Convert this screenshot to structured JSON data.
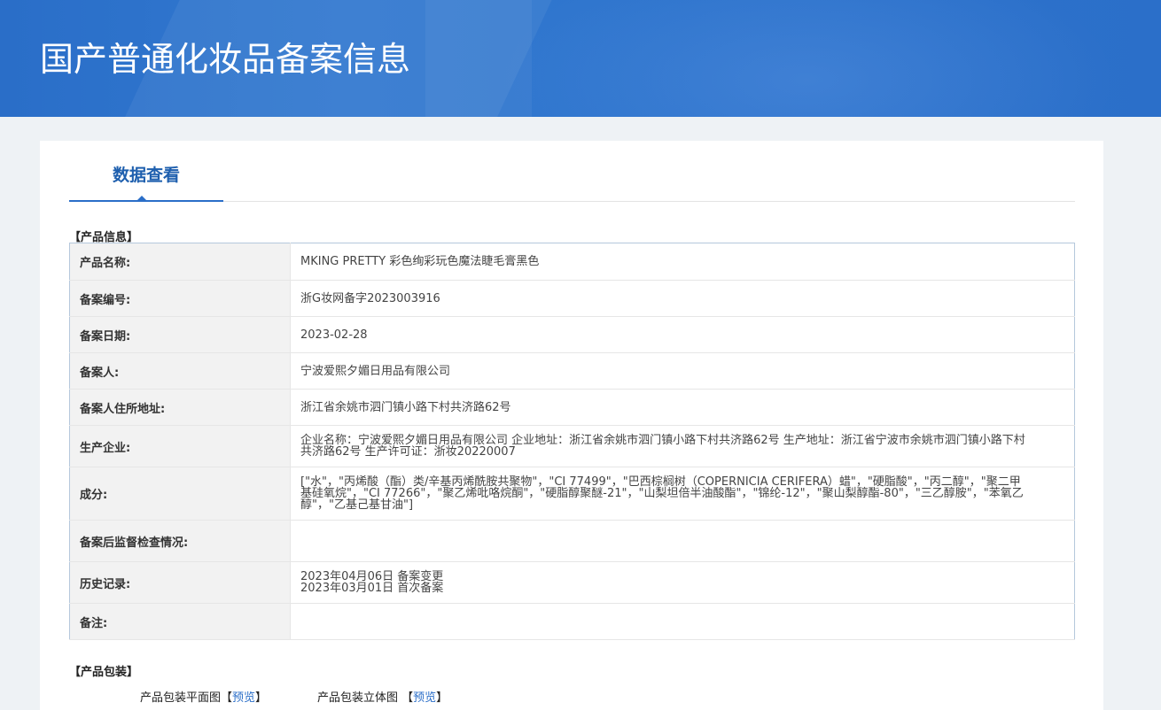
{
  "banner": {
    "title": "国产普通化妆品备案信息"
  },
  "tabs": [
    {
      "label": "数据查看"
    }
  ],
  "product_info": {
    "section_title": "【产品信息】",
    "rows": [
      {
        "key": "产品名称:",
        "value": "MKING PRETTY 彩色绚彩玩色魔法睫毛膏黑色"
      },
      {
        "key": "备案编号:",
        "value": "浙G妆网备字2023003916"
      },
      {
        "key": "备案日期:",
        "value": "2023-02-28"
      },
      {
        "key": "备案人:",
        "value": "宁波爱熙夕媚日用品有限公司"
      },
      {
        "key": "备案人住所地址:",
        "value": "浙江省余姚市泗门镇小路下村共济路62号"
      },
      {
        "key": "生产企业:",
        "value": "企业名称：宁波爱熙夕媚日用品有限公司 企业地址：浙江省余姚市泗门镇小路下村共济路62号 生产地址：浙江省宁波市余姚市泗门镇小路下村共济路62号 生产许可证：浙妆20220007"
      },
      {
        "key": "成分:",
        "value": "[\"水\"，\"丙烯酸（酯）类/辛基丙烯酰胺共聚物\"，\"CI 77499\"，\"巴西棕榈树（COPERNICIA CERIFERA）蜡\"，\"硬脂酸\"，\"丙二醇\"，\"聚二甲基硅氧烷\"，\"CI 77266\"，\"聚乙烯吡咯烷酮\"，\"硬脂醇聚醚-21\"，\"山梨坦倍半油酸酯\"，\"锦纶-12\"，\"聚山梨醇酯-80\"，\"三乙醇胺\"，\"苯氧乙醇\"，\"乙基己基甘油\"]"
      },
      {
        "key": "备案后监督检查情况:",
        "value": ""
      },
      {
        "key": "历史记录:",
        "value": "",
        "lines": [
          "2023年04月06日 备案变更",
          "2023年03月01日 首次备案"
        ]
      },
      {
        "key": "备注:",
        "value": ""
      }
    ]
  },
  "packaging": {
    "section_title": "【产品包装】",
    "items": [
      {
        "label": "产品包装平面图",
        "bracket_open": "【",
        "link": "预览",
        "bracket_close": "】"
      },
      {
        "label": "产品包装立体图",
        "bracket_open": " 【",
        "link": "预览",
        "bracket_close": "】"
      }
    ]
  }
}
